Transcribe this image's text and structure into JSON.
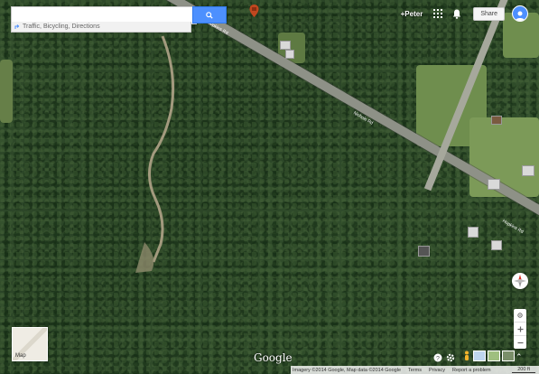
{
  "search": {
    "value": "",
    "placeholder": "",
    "suggestion": "Traffic, Bicycling, Directions"
  },
  "header": {
    "user_label": "+Peter",
    "share_label": "Share"
  },
  "map_type": {
    "thumbnail_label": "Map"
  },
  "brand": {
    "logo_text": "Google"
  },
  "footer": {
    "imagery": "Imagery ©2014 Google, Map data ©2014 Google",
    "terms": "Terms",
    "privacy": "Privacy",
    "report": "Report a problem",
    "scale": "200 ft"
  },
  "map_labels": {
    "road_1": "Hopkins Rd",
    "road_2": "Nichols Rd",
    "road_3": "Hopkins Rd"
  },
  "colors": {
    "accent": "#4d90fe",
    "button_border": "#3079ed",
    "compass_north": "#d93025"
  },
  "icons": {
    "search": "search-icon",
    "place": "pin-icon",
    "apps": "apps-grid-icon",
    "notifications": "bell-icon",
    "account": "avatar-icon",
    "compass": "compass-icon",
    "pegman": "pegman-icon",
    "expand": "chevron-up-icon"
  }
}
